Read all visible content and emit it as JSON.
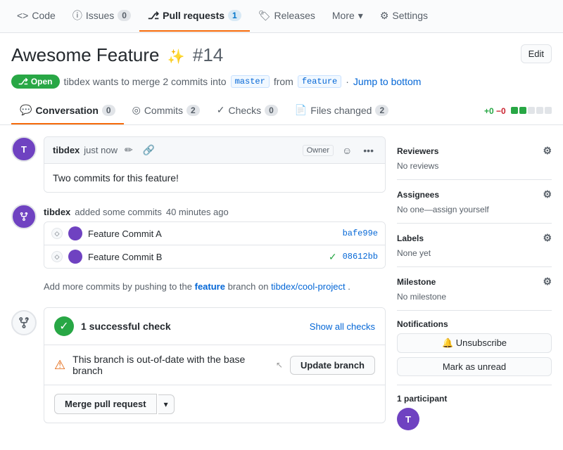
{
  "topnav": {
    "items": [
      {
        "id": "code",
        "label": "Code",
        "icon": "code-icon",
        "badge": null,
        "active": false
      },
      {
        "id": "issues",
        "label": "Issues",
        "icon": "issues-icon",
        "badge": "0",
        "active": false
      },
      {
        "id": "pull-requests",
        "label": "Pull requests",
        "icon": "pr-icon",
        "badge": "1",
        "active": true
      },
      {
        "id": "releases",
        "label": "Releases",
        "icon": "tag-icon",
        "badge": null,
        "active": false
      },
      {
        "id": "more",
        "label": "More",
        "icon": "chevron-icon",
        "badge": null,
        "active": false
      },
      {
        "id": "settings",
        "label": "Settings",
        "icon": "gear-icon",
        "badge": null,
        "active": false
      }
    ]
  },
  "pr": {
    "title": "Awesome Feature",
    "sparkle": "✨",
    "number": "#14",
    "edit_label": "Edit",
    "status": "Open",
    "status_icon": "git-merge-icon",
    "description": "tibdex wants to merge 2 commits into",
    "base_branch": "master",
    "from_text": "from",
    "head_branch": "feature",
    "jump_label": "Jump to bottom"
  },
  "tabs": {
    "items": [
      {
        "id": "conversation",
        "label": "Conversation",
        "icon": "comment-icon",
        "badge": "0",
        "active": true
      },
      {
        "id": "commits",
        "label": "Commits",
        "icon": "commits-icon",
        "badge": "2",
        "active": false
      },
      {
        "id": "checks",
        "label": "Checks",
        "icon": "checks-icon",
        "badge": "0",
        "active": false
      },
      {
        "id": "files",
        "label": "Files changed",
        "icon": "files-icon",
        "badge": "2",
        "active": false
      }
    ],
    "diff_stat": {
      "add": "+0",
      "rem": "−0",
      "blocks": [
        "green",
        "green",
        "gray",
        "gray",
        "gray"
      ]
    }
  },
  "comment": {
    "author": "tibdex",
    "time": "just now",
    "owner_badge": "Owner",
    "body": "Two commits for this feature!",
    "emoji_btn": "😊",
    "more_btn": "..."
  },
  "commits_event": {
    "committer": "tibdex",
    "action": "added some commits",
    "time": "40 minutes ago",
    "commits": [
      {
        "msg": "Feature Commit A",
        "sha": "bafe99e",
        "check": false
      },
      {
        "msg": "Feature Commit B",
        "sha": "08612bb",
        "check": true
      }
    ]
  },
  "push_message": {
    "prefix": "Add more commits by pushing to the",
    "branch": "feature",
    "middle": "branch on",
    "repo": "tibdex/cool-project",
    "suffix": "."
  },
  "checks": {
    "success_count": "1 successful check",
    "show_all_label": "Show all checks",
    "warning_text": "This branch is out-of-date with the base branch",
    "update_btn_label": "Update branch",
    "warning_icon": "⚠"
  },
  "merge": {
    "merge_btn_label": "Merge pull request",
    "dropdown_icon": "▾"
  },
  "sidebar": {
    "reviewers": {
      "title": "Reviewers",
      "value": "No reviews",
      "gear_title": "reviewers-gear"
    },
    "assignees": {
      "title": "Assignees",
      "value": "No one—assign yourself",
      "gear_title": "assignees-gear"
    },
    "labels": {
      "title": "Labels",
      "value": "None yet",
      "gear_title": "labels-gear"
    },
    "milestone": {
      "title": "Milestone",
      "value": "No milestone",
      "gear_title": "milestone-gear"
    },
    "notifications": {
      "title": "Notifications",
      "unsubscribe_label": "🔔 Unsubscribe",
      "unread_label": "Mark as unread"
    },
    "participants": {
      "title": "1 participant",
      "initials": "T"
    }
  }
}
